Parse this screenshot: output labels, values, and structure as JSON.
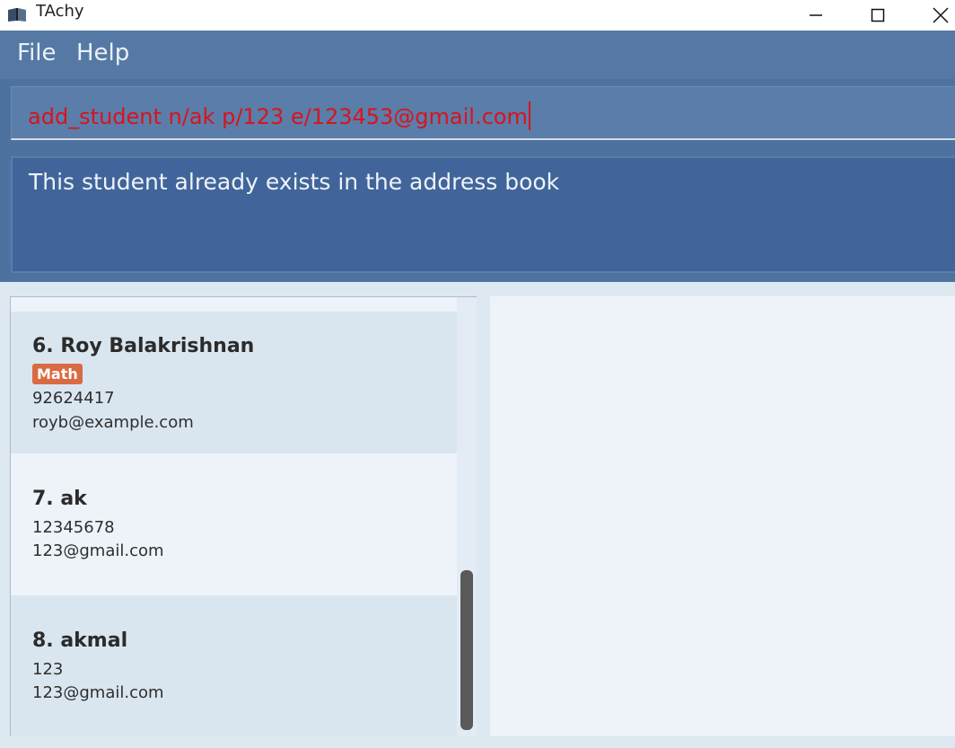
{
  "window": {
    "title": "TAchy",
    "icon": "book-icon"
  },
  "menu": {
    "file": "File",
    "help": "Help"
  },
  "command": {
    "value": "add_student n/ak p/123 e/123453@gmail.com"
  },
  "result": {
    "message": "This student already exists in the address book"
  },
  "students": [
    {
      "name": "6. Roy Balakrishnan",
      "tag": "Math",
      "phone": "92624417",
      "email": "royb@example.com"
    },
    {
      "name": "7. ak",
      "phone": "12345678",
      "email": "123@gmail.com"
    },
    {
      "name": "8. akmal",
      "phone": "123",
      "email": "123@gmail.com"
    }
  ],
  "colors": {
    "menu_bg": "#5579a4",
    "command_text": "#d8131e",
    "tag_bg": "#d96b43"
  }
}
